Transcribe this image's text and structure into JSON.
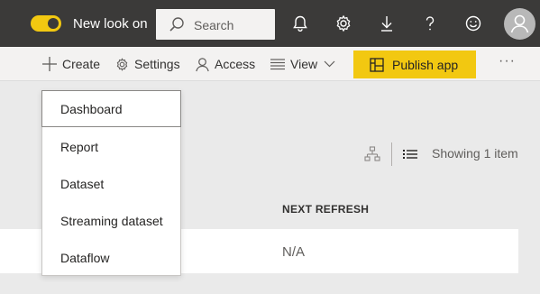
{
  "topbar": {
    "toggle_label": "New look on",
    "toggle_on": true,
    "search_placeholder": "Search",
    "icons": [
      "bell-icon",
      "gear-icon",
      "download-icon",
      "help-icon",
      "smiley-icon",
      "avatar"
    ]
  },
  "commandbar": {
    "create": "Create",
    "settings": "Settings",
    "access": "Access",
    "view": "View",
    "publish": "Publish app",
    "more": "···"
  },
  "create_menu": {
    "items": [
      {
        "label": "Dashboard"
      },
      {
        "label": "Report"
      },
      {
        "label": "Dataset"
      },
      {
        "label": "Streaming dataset"
      },
      {
        "label": "Dataflow"
      }
    ]
  },
  "content": {
    "showing": "Showing 1 item",
    "columns": [
      "NEXT REFRESH"
    ],
    "rows": [
      {
        "next_refresh": "N/A"
      }
    ]
  },
  "colors": {
    "topbar_bg": "#3b3a39",
    "accent_yellow": "#f2c811",
    "page_bg": "#eaeaea"
  }
}
